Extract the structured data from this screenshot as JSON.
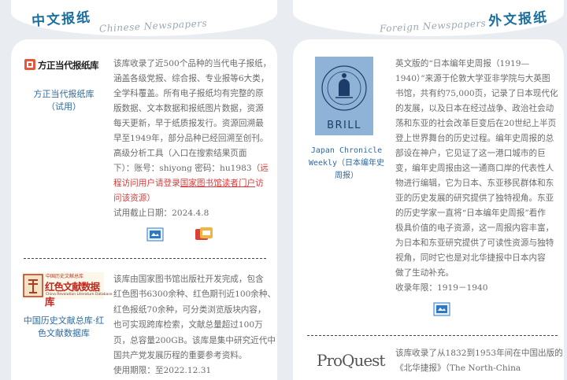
{
  "left": {
    "title": "中文报纸",
    "subtitle": "Chinese Newspapers",
    "item1": {
      "logo_text": "方正当代报纸库",
      "name_line1": "方正当代报纸库",
      "name_line2": "（试用）",
      "desc_lines": [
        "该库收录了近500个品种的当代电子报纸，",
        "涵盖各级党报、综合报、专业报等6大类，",
        "全学科覆盖。所有电子报纸均有完整的原",
        "版数据、文本数据和报纸图片数据，资源",
        "每天更新，早于纸质报发行。资源回溯最",
        "早至1949年，部分品种已经回溯至创刊。",
        "高级分析工具（入口在搜索结果页面",
        "下）：账号：shiyong 密码：hu1983"
      ],
      "remote_part1": "（远",
      "remote_line2_a": "程访问用户请登录",
      "remote_link": "国家图书馆读者门户",
      "remote_line2_b": "访",
      "remote_line3": "问该资源）",
      "trial_end": "试用截止日期：2024.4.8"
    },
    "item2": {
      "logo_top": "中国历史文献总库",
      "logo_main": "红色文献数据库",
      "logo_en": "China Revolution Literature Database",
      "name_line1": "中国历史文献总库·红",
      "name_line2": "色文献数据库",
      "desc_lines": [
        "该库由国家图书馆出版社开发完成，包含",
        "红色图书6300余种、红色期刊近100余种、",
        "红色报纸70余种，可分类浏览版块内容，",
        "也可实现跨库检索，文献总量超过100万",
        "页，总容量200GB。该库是集中研究近代中",
        "国共产党发展历程的重要参考资料。"
      ],
      "period": "使用期限：至2022.12.31"
    }
  },
  "right": {
    "title": "外文报纸",
    "subtitle": "Foreign Newspapers",
    "item1": {
      "logo_text": "BRILL",
      "name_line1": "Japan Chronicle",
      "name_line2": "Weekly（日本编年史",
      "name_line3": "周报）",
      "desc_lines": [
        "英文版的“日本编年史周报（1919—",
        "1940）”来源于伦敦大学亚非学院与大英图",
        "书馆，共有约75,000页，记录了日本现代化",
        "的发展，以及日本在经过战争、政治社会动",
        "荡和东亚的社会改革巨变后在20世纪上半页",
        "登上世界舞台的历史过程。编年史周报的总",
        "部设在神户，它见证了这一港口城市的巨",
        "变，编年史周报由这一通商口岸的代表性人",
        "物进行编辑，它为日本、东亚移民群体和东",
        "亚的历史发展的研究提供了独特视角。东亚",
        "的历史学家一直将“日本编年史周报”看作",
        "极具价值的电子资源，这一周报内容丰富，",
        "为日本和东亚研究提供了可读性资源与独特",
        "视角，同时它也是对北华捷报中日本内容",
        "做了生动补充。"
      ],
      "years": "收录年限：1919－1940"
    },
    "item2": {
      "logo_text": "ProQuest",
      "desc_lines": [
        "该库收录了从1832到1953年间在中国出版的",
        "《北华捷报》（The North-China"
      ]
    }
  }
}
